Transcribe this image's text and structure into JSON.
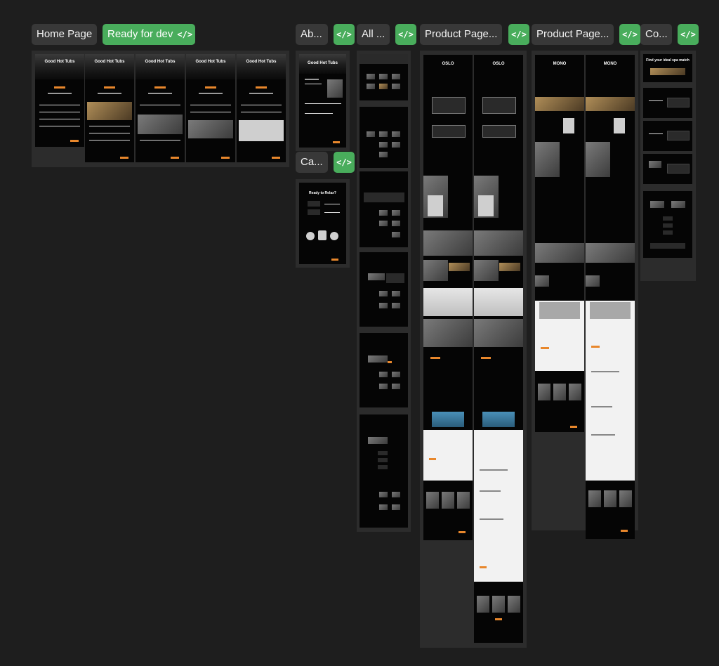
{
  "canvas": {
    "background": "#1e1e1e",
    "accent": "#49ad5c",
    "orange": "#e8872c"
  },
  "pages": {
    "home": {
      "label": "Home Page",
      "status": "Ready for dev",
      "dev_icon": "code-icon"
    },
    "about": {
      "label": "Ab..."
    },
    "all": {
      "label": "All ..."
    },
    "product_a": {
      "label": "Product Page..."
    },
    "product_b": {
      "label": "Product Page..."
    },
    "contact": {
      "label": "Co..."
    },
    "cart": {
      "label": "Ca..."
    }
  },
  "code_glyph": "</>",
  "thumbnails": {
    "home_hero": "Good Hot Tubs",
    "about_hero": "Good Hot Tubs",
    "oslo_brand": "OSLO",
    "mono_brand": "MONO"
  }
}
